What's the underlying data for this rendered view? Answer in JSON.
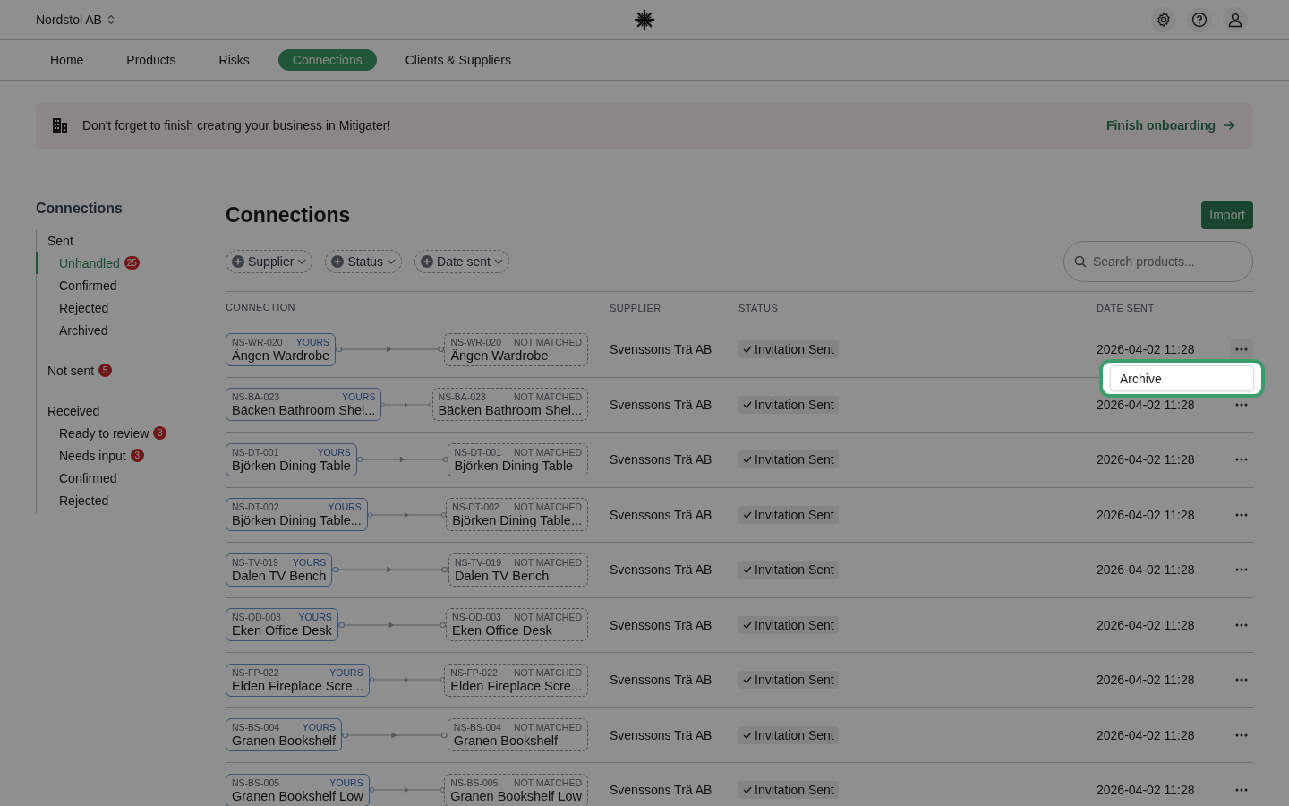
{
  "header": {
    "organization": "Nordstol AB"
  },
  "nav": [
    {
      "label": "Home",
      "selected": false
    },
    {
      "label": "Products",
      "selected": false
    },
    {
      "label": "Risks",
      "selected": false
    },
    {
      "label": "Connections",
      "selected": true
    },
    {
      "label": "Clients & Suppliers",
      "selected": false
    }
  ],
  "banner": {
    "message": "Don't forget to finish creating your business in Mitigater!",
    "action": "Finish onboarding"
  },
  "sidebar": {
    "title": "Connections",
    "groups": [
      {
        "label": "Sent",
        "items": [
          {
            "label": "Unhandled",
            "badge": "25",
            "selected": true
          },
          {
            "label": "Confirmed",
            "selected": false
          },
          {
            "label": "Rejected",
            "selected": false
          },
          {
            "label": "Archived",
            "selected": false
          }
        ]
      },
      {
        "label": "Not sent",
        "badge": "5"
      },
      {
        "label": "Received",
        "items": [
          {
            "label": "Ready to review",
            "badge": "3",
            "selected": false
          },
          {
            "label": "Needs input",
            "badge": "3",
            "selected": false
          },
          {
            "label": "Confirmed",
            "selected": false
          },
          {
            "label": "Rejected",
            "selected": false
          }
        ]
      }
    ]
  },
  "page": {
    "title": "Connections",
    "import_button": "Import",
    "filters": [
      "Supplier",
      "Status",
      "Date sent"
    ],
    "search": {
      "placeholder": "Search products..."
    }
  },
  "table": {
    "columns": [
      "CONNECTION",
      "SUPPLIER",
      "STATUS",
      "DATE SENT"
    ],
    "rows": [
      {
        "left": {
          "code": "NS-WR-020",
          "tag": "YOURS",
          "kind": "yours",
          "name": "Ängen Wardrobe"
        },
        "right": {
          "code": "NS-WR-020",
          "tag": "NOT MATCHED",
          "kind": "not_matched",
          "name": "Ängen Wardrobe"
        },
        "supplier": "Svenssons Trä AB",
        "status": "Invitation Sent",
        "date": "2026-04-02 11:28",
        "menu": {
          "items": [
            "Archive"
          ]
        }
      },
      {
        "left": {
          "code": "NS-BA-023",
          "tag": "YOURS",
          "kind": "yours",
          "name": "Bäcken Bathroom Shel..."
        },
        "right": {
          "code": "NS-BA-023",
          "tag": "NOT MATCHED",
          "kind": "not_matched",
          "name": "Bäcken Bathroom Shel..."
        },
        "supplier": "Svenssons Trä AB",
        "status": "Invitation Sent",
        "date": "2026-04-02 11:28"
      },
      {
        "left": {
          "code": "NS-DT-001",
          "tag": "YOURS",
          "kind": "yours",
          "name": "Björken Dining Table"
        },
        "right": {
          "code": "NS-DT-001",
          "tag": "NOT MATCHED",
          "kind": "not_matched",
          "name": "Björken Dining Table"
        },
        "supplier": "Svenssons Trä AB",
        "status": "Invitation Sent",
        "date": "2026-04-02 11:28"
      },
      {
        "left": {
          "code": "NS-DT-002",
          "tag": "YOURS",
          "kind": "yours",
          "name": "Björken Dining Table..."
        },
        "right": {
          "code": "NS-DT-002",
          "tag": "NOT MATCHED",
          "kind": "not_matched",
          "name": "Björken Dining Table..."
        },
        "supplier": "Svenssons Trä AB",
        "status": "Invitation Sent",
        "date": "2026-04-02 11:28"
      },
      {
        "left": {
          "code": "NS-TV-019",
          "tag": "YOURS",
          "kind": "yours",
          "name": "Dalen TV Bench"
        },
        "right": {
          "code": "NS-TV-019",
          "tag": "NOT MATCHED",
          "kind": "not_matched",
          "name": "Dalen TV Bench"
        },
        "supplier": "Svenssons Trä AB",
        "status": "Invitation Sent",
        "date": "2026-04-02 11:28"
      },
      {
        "left": {
          "code": "NS-OD-003",
          "tag": "YOURS",
          "kind": "yours",
          "name": "Eken Office Desk"
        },
        "right": {
          "code": "NS-OD-003",
          "tag": "NOT MATCHED",
          "kind": "not_matched",
          "name": "Eken Office Desk"
        },
        "supplier": "Svenssons Trä AB",
        "status": "Invitation Sent",
        "date": "2026-04-02 11:28"
      },
      {
        "left": {
          "code": "NS-FP-022",
          "tag": "YOURS",
          "kind": "yours",
          "name": "Elden Fireplace Scre..."
        },
        "right": {
          "code": "NS-FP-022",
          "tag": "NOT MATCHED",
          "kind": "not_matched",
          "name": "Elden Fireplace Scre..."
        },
        "supplier": "Svenssons Trä AB",
        "status": "Invitation Sent",
        "date": "2026-04-02 11:28"
      },
      {
        "left": {
          "code": "NS-BS-004",
          "tag": "YOURS",
          "kind": "yours",
          "name": "Granen Bookshelf"
        },
        "right": {
          "code": "NS-BS-004",
          "tag": "NOT MATCHED",
          "kind": "not_matched",
          "name": "Granen Bookshelf"
        },
        "supplier": "Svenssons Trä AB",
        "status": "Invitation Sent",
        "date": "2026-04-02 11:28"
      },
      {
        "left": {
          "code": "NS-BS-005",
          "tag": "YOURS",
          "kind": "yours",
          "name": "Granen Bookshelf Low"
        },
        "right": {
          "code": "NS-BS-005",
          "tag": "NOT MATCHED",
          "kind": "not_matched",
          "name": "Granen Bookshelf Low"
        },
        "supplier": "Svenssons Trä AB",
        "status": "Invitation Sent",
        "date": "2026-04-02 11:28"
      }
    ]
  }
}
